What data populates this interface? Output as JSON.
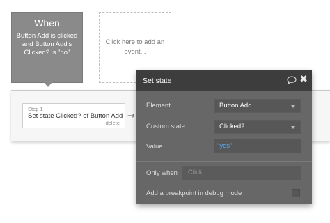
{
  "event_card": {
    "title": "When",
    "description": "Button Add is clicked and Button Add's Clicked? is \"no\""
  },
  "add_event": {
    "label": "Click here to add an event..."
  },
  "step": {
    "label": "Step 1",
    "text": "Set state Clicked? of Button Add",
    "delete_label": "delete",
    "arrow": "→"
  },
  "panel": {
    "title": "Set state",
    "close": "✖",
    "element_label": "Element",
    "element_value": "Button Add",
    "custom_state_label": "Custom state",
    "custom_state_value": "Clicked?",
    "value_label": "Value",
    "value_value": "\"yes\"",
    "only_when_label": "Only when",
    "only_when_placeholder": "Click",
    "breakpoint_label": "Add a breakpoint in debug mode"
  },
  "colors": {
    "panel_bg": "#676767",
    "panel_header": "#3d3d3d",
    "value_text": "#5aa9ee",
    "event_card_bg": "#8a8a8a"
  }
}
